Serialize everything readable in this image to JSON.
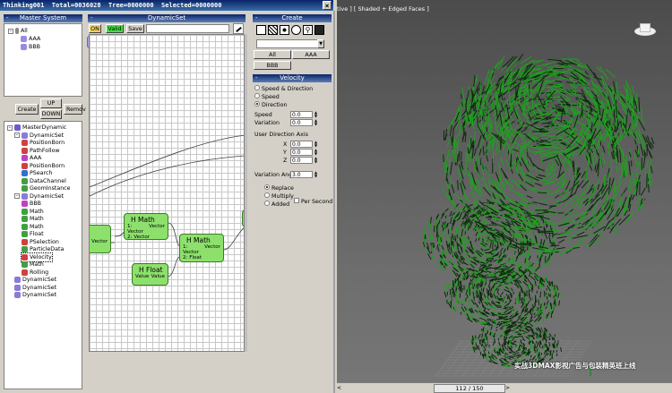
{
  "title": {
    "app": "Thinking001",
    "total": "Total=0036028",
    "tree": "Tree=0000000",
    "selected": "Selected=0000000"
  },
  "master": {
    "header": "Master System",
    "items": [
      {
        "label": "All",
        "expand": "-"
      },
      {
        "label": "AAA"
      },
      {
        "label": "BBB"
      }
    ]
  },
  "buttons": {
    "create": "Create",
    "up": "UP",
    "down": "DOWN",
    "remove": "Remov"
  },
  "operators": [
    {
      "label": "MasterDynamic",
      "level": 0,
      "expand": "-",
      "color": "#6a5acd"
    },
    {
      "label": "DynamicSet",
      "level": 1,
      "expand": "-",
      "color": "#8a7bd6"
    },
    {
      "label": "PositionBorn",
      "level": 2,
      "color": "#d04040"
    },
    {
      "label": "PathFollow",
      "level": 2,
      "color": "#d04040"
    },
    {
      "label": "AAA",
      "level": 2,
      "color": "#c040c0"
    },
    {
      "label": "PositionBorn",
      "level": 2,
      "color": "#d04040"
    },
    {
      "label": "PSearch",
      "level": 2,
      "color": "#3070d0"
    },
    {
      "label": "DataChannel",
      "level": 2,
      "color": "#40a040"
    },
    {
      "label": "GeomInstance",
      "level": 2,
      "color": "#40a040"
    },
    {
      "label": "DynamicSet",
      "level": 1,
      "expand": "-",
      "color": "#8a7bd6"
    },
    {
      "label": "BBB",
      "level": 2,
      "color": "#c040c0"
    },
    {
      "label": "Math",
      "level": 2,
      "color": "#40a040"
    },
    {
      "label": "Math",
      "level": 2,
      "color": "#40a040"
    },
    {
      "label": "Math",
      "level": 2,
      "color": "#40a040"
    },
    {
      "label": "Float",
      "level": 2,
      "color": "#40a040"
    },
    {
      "label": "PSelection",
      "level": 2,
      "color": "#d04040"
    },
    {
      "label": "ParticleData",
      "level": 2,
      "color": "#40a040"
    },
    {
      "label": "Velocity",
      "level": 2,
      "color": "#d04040",
      "selected": true
    },
    {
      "label": "Math",
      "level": 2,
      "color": "#40a040"
    },
    {
      "label": "Rolling",
      "level": 2,
      "color": "#d04040"
    },
    {
      "label": "DynamicSet",
      "level": 1,
      "color": "#8a7bd6"
    },
    {
      "label": "DynamicSet",
      "level": 1,
      "color": "#8a7bd6"
    },
    {
      "label": "DynamicSet",
      "level": 1,
      "color": "#8a7bd6"
    }
  ],
  "dynset": {
    "header": "DynamicSet",
    "on": "ON",
    "valid": "Valid",
    "save": "Save",
    "name_value": ""
  },
  "nodes": [
    {
      "title": "H Math",
      "in": "1: Vector",
      "in2": "2: Vector",
      "out": "Vector"
    },
    {
      "title": "H Math",
      "in": "1: Vector",
      "in2": "2: Float",
      "out": "Vector"
    },
    {
      "title": "H Float",
      "in": "Value",
      "out": "Value"
    },
    {
      "out": "Vector"
    }
  ],
  "create": {
    "header": "Create",
    "all": "All",
    "aaa": "AAA",
    "bbb": "BBB"
  },
  "velocity": {
    "header": "Velocity",
    "modes": [
      {
        "label": "Speed & Direction",
        "on": false
      },
      {
        "label": "Speed",
        "on": false
      },
      {
        "label": "Direction",
        "on": true
      }
    ],
    "speed_label": "Speed",
    "speed": "0.0",
    "variation_label": "Variation",
    "variation": "0.0",
    "uda_label": "User Direction Axis",
    "x_label": "X",
    "x": "0.0",
    "y_label": "Y",
    "y": "0.0",
    "z_label": "Z",
    "z": "0.0",
    "va_label": "Variation Angle",
    "va": "3.0",
    "blend": [
      {
        "label": "Replace",
        "on": true
      },
      {
        "label": "Multiply",
        "on": false
      },
      {
        "label": "Added",
        "on": false
      }
    ],
    "per_second": "Per Second"
  },
  "viewport": {
    "label": "tive ] [ Shaded + Edged Faces ]",
    "frame": "112 / 150",
    "watermark": "实战3DMAX影视广告与包装精英班上线",
    "accent": "#1f8a1f"
  }
}
